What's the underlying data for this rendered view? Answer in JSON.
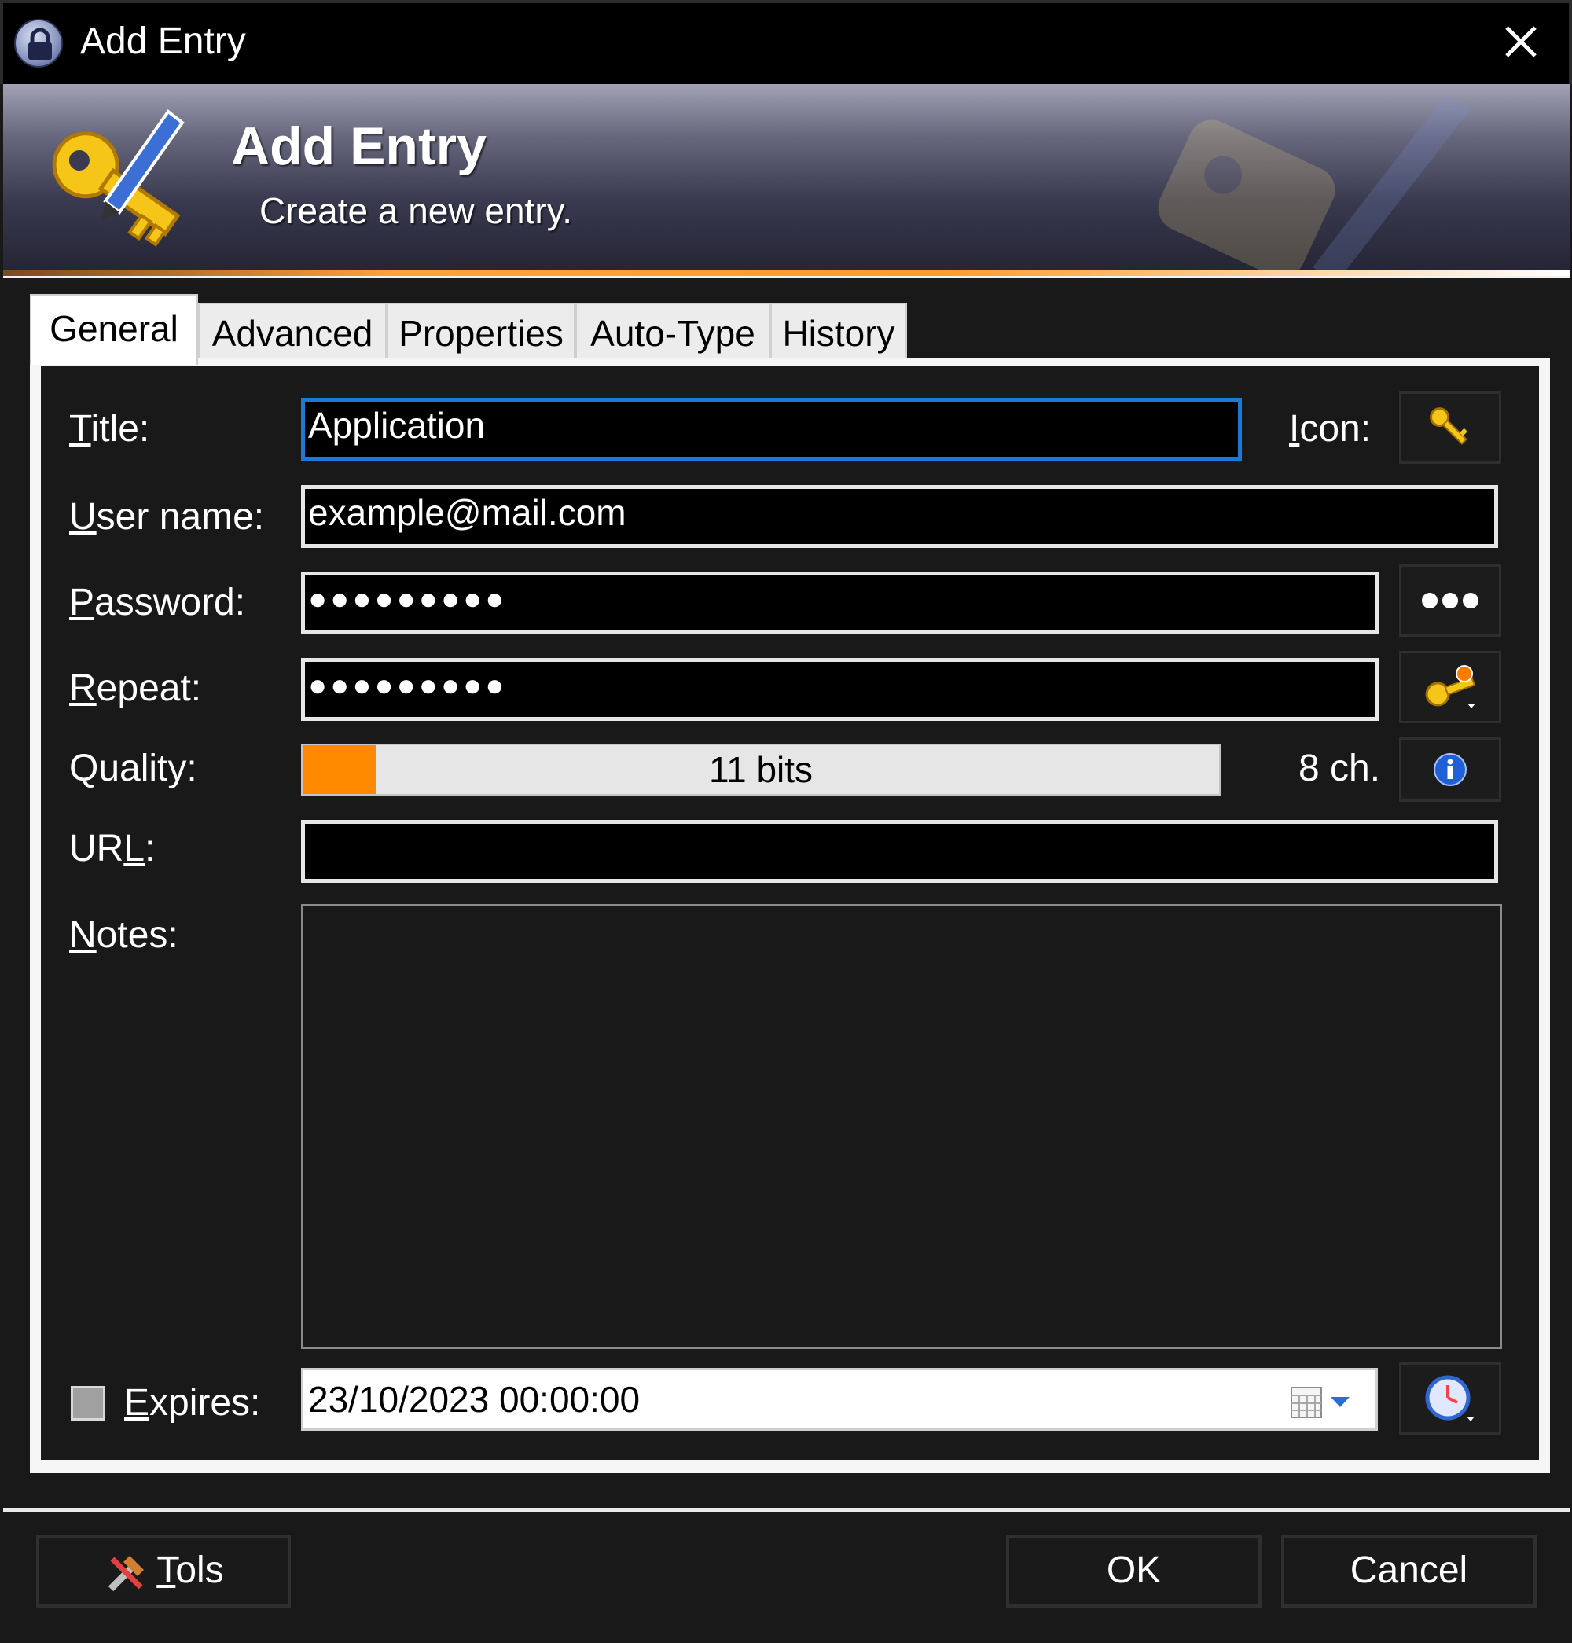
{
  "window": {
    "title": "Add Entry"
  },
  "banner": {
    "title": "Add Entry",
    "subtitle": "Create a new entry."
  },
  "tabs": [
    {
      "label": "General",
      "active": true
    },
    {
      "label": "Advanced",
      "active": false
    },
    {
      "label": "Properties",
      "active": false
    },
    {
      "label": "Auto-Type",
      "active": false
    },
    {
      "label": "History",
      "active": false
    }
  ],
  "form": {
    "title_label_rest": "itle:",
    "title_value": "Application",
    "icon_label_rest": "con:",
    "username_label_rest": "ser name:",
    "username_value": "example@mail.com",
    "password_label_rest": "assword:",
    "password_value": "●●●●●●●●●",
    "repeat_label_rest": "epeat:",
    "repeat_value": "●●●●●●●●●",
    "quality_label": "Quality:",
    "quality_text": "11 bits",
    "quality_fraction": 0.08,
    "char_count": "8 ch.",
    "url_label_pre": "UR",
    "url_label_rest": ":",
    "url_value": "",
    "notes_label_rest": "otes:",
    "notes_value": "",
    "expires_label_rest": "xpires:",
    "expires_checked": false,
    "expires_value": "23/10/2023 00:00:00"
  },
  "buttons": {
    "tools_pre": "T",
    "tools_rest": "ols",
    "ok": "OK",
    "cancel": "Cancel"
  },
  "colors": {
    "quality_fill": "#ff8a00",
    "focus_border": "#1a7ad8",
    "accent_strip": "#ff9c2b"
  }
}
